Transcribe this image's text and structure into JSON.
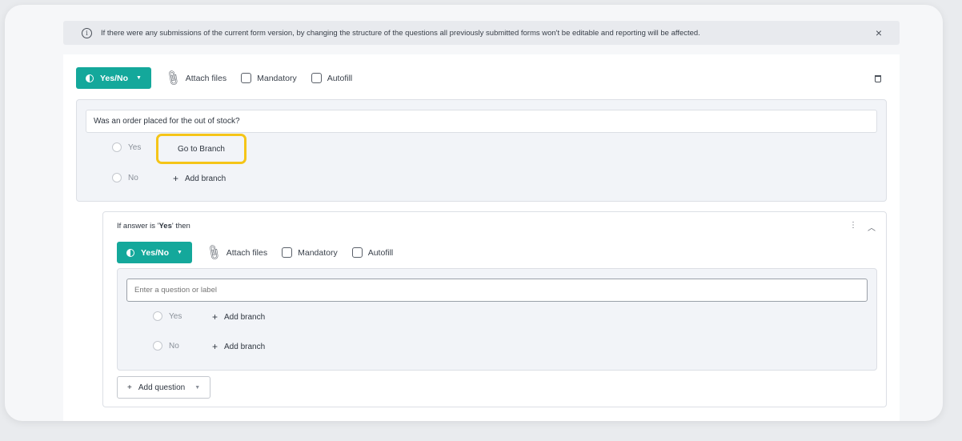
{
  "banner": {
    "message": "If there were any submissions of the current form version, by changing the structure of the questions all previously submitted forms won't be editable and reporting will be affected.",
    "close_glyph": "×",
    "info_glyph": "i"
  },
  "toolbar": {
    "type_label": "Yes/No",
    "attach_label": "Attach files",
    "mandatory_label": "Mandatory",
    "autofill_label": "Autofill"
  },
  "question1": {
    "text": "Was an order placed for the out of stock?",
    "options": [
      {
        "label": "Yes",
        "action": "Go to Branch"
      },
      {
        "label": "No",
        "action": "Add branch"
      }
    ]
  },
  "subquestion": {
    "condition_prefix": "If answer is '",
    "condition_value": "Yes",
    "condition_suffix": "' then",
    "type_label": "Yes/No",
    "attach_label": "Attach files",
    "mandatory_label": "Mandatory",
    "autofill_label": "Autofill",
    "input_placeholder": "Enter a question or label",
    "options": [
      {
        "label": "Yes",
        "action": "Add branch"
      },
      {
        "label": "No",
        "action": "Add branch"
      }
    ],
    "add_question_label": "Add question"
  },
  "highlight_color": "#f5c518",
  "accent_color": "#14a89b"
}
